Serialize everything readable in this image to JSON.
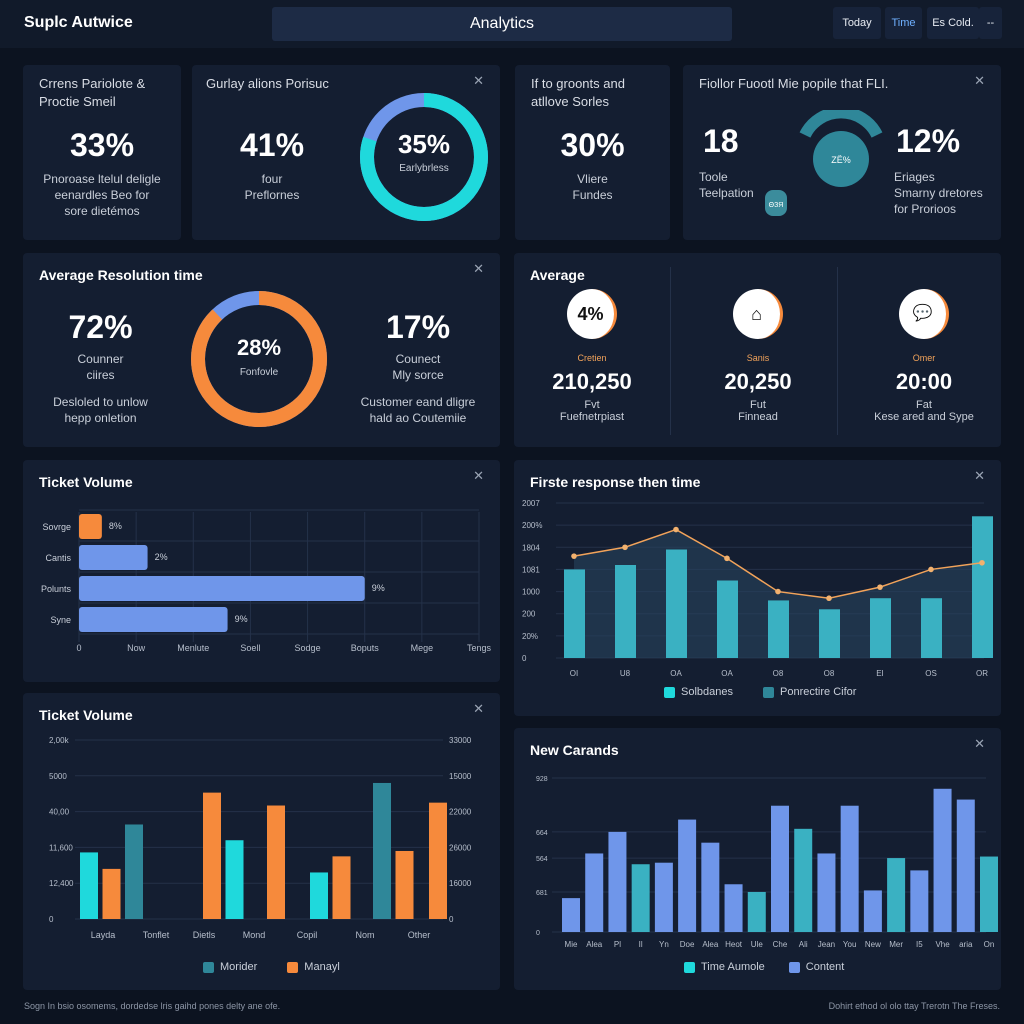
{
  "header": {
    "brand": "Suplc Autwice",
    "title": "Analytics",
    "buttons": [
      "Today",
      "Time",
      "Es Cold.",
      "--"
    ]
  },
  "colors": {
    "cyan": "#1fd9dc",
    "orange": "#f68a3c",
    "blue": "#6f96ea",
    "teal": "#2f8799",
    "bg": "#0c1320",
    "card": "#141e31"
  },
  "row1": [
    {
      "title": "Crrens Pariolote & Proctie Smeil",
      "value": "33%",
      "desc": [
        "Pnoroase ltelul deligle",
        "eenardles Beo for",
        "sore dietémos"
      ]
    },
    {
      "title": "Gurlay alions Porisuc",
      "value": "41%",
      "desc": [
        "four",
        "Preflornes"
      ],
      "donut_value": "35%",
      "donut_label": "Earlybrless",
      "donut_cyan_fraction": 0.8
    },
    {
      "title": "If to groonts and atllove Sorles",
      "value": "30%",
      "desc": [
        "Vliere",
        "Fundes"
      ]
    },
    {
      "title": "Fiollor Fuootl Mie popile that FLI.",
      "value1": "18",
      "desc1": [
        "Toole",
        "Teelpation"
      ],
      "gauge_text": "ZЁ%",
      "bag_text": "ΘЗЯ",
      "value2": "12%",
      "desc2": [
        "Eriages",
        "Smarny dretores",
        "for Prorioos"
      ]
    }
  ],
  "resolution": {
    "title": "Average Resolution time",
    "left_value": "72%",
    "left_desc": [
      "Counner",
      "ciires"
    ],
    "left_note": [
      "Desloled to unlow",
      "hepp onletion"
    ],
    "donut_value": "28%",
    "donut_label": "Fonfovle",
    "donut_orange_fraction": 0.88,
    "right_value": "17%",
    "right_desc": [
      "Counect",
      "Mly sorce"
    ],
    "right_note": [
      "Customer eand dligre",
      "hald ao Coutemiie"
    ]
  },
  "average": {
    "title": "Average",
    "items": [
      {
        "icon": "percent-icon",
        "icon_text": "4%",
        "label": "Cretien",
        "value": "210,250",
        "unit": "Fvt",
        "desc": "Fuefnetrpiast"
      },
      {
        "icon": "home-icon",
        "label": "Sanis",
        "value": "20,250",
        "unit": "Fut",
        "desc": "Finnead"
      },
      {
        "icon": "chat-icon",
        "label": "Omer",
        "value": "20:00",
        "unit": "Fat",
        "desc": "Kese ared and Sype"
      }
    ]
  },
  "chart_data": [
    {
      "type": "bar",
      "orientation": "horizontal",
      "title": "Ticket Volume",
      "categories": [
        "Sovrge",
        "Cantis",
        "Polunts",
        "Syne"
      ],
      "values": [
        0.4,
        1.2,
        5.0,
        2.6
      ],
      "data_labels": [
        "8%",
        "2%",
        "9%",
        "9%"
      ],
      "colors": [
        "#f68a3c",
        "#6f96ea",
        "#6f96ea",
        "#6f96ea"
      ],
      "xticks": [
        "0",
        "Now",
        "Menlute",
        "Soell",
        "Sodge",
        "Boputs",
        "Mege",
        "Tengs"
      ],
      "xlim": [
        0,
        7
      ],
      "grid": true
    },
    {
      "type": "bar+line",
      "title": "Firste response then time",
      "categories": [
        "OI",
        "U8",
        "OA",
        "OA",
        "O8",
        "O8",
        "EI",
        "OS",
        "OR"
      ],
      "yticks": [
        "0",
        "20%",
        "200",
        "1000",
        "1081",
        "1804",
        "200%",
        "2007"
      ],
      "ylim": [
        0,
        7
      ],
      "series": [
        {
          "name": "Solbdanes",
          "type": "bar",
          "color": "#3ab1c2",
          "values": [
            4.0,
            4.2,
            4.9,
            3.5,
            2.6,
            2.2,
            2.7,
            2.7,
            6.4
          ]
        },
        {
          "name": "Ponrectire Cifor",
          "type": "line",
          "color": "#f2a35a",
          "values": [
            4.6,
            5.0,
            5.8,
            4.5,
            3.0,
            2.7,
            3.2,
            4.0,
            4.3
          ]
        }
      ],
      "legend": "bottom",
      "grid": true
    },
    {
      "type": "bar",
      "title": "Ticket Volume",
      "categories": [
        "Layda",
        "Tonflet",
        "Dietls",
        "Mond",
        "Copil",
        "Nom",
        "Other"
      ],
      "yticks_left": [
        "0",
        "12,400",
        "11,600",
        "40,00",
        "5000",
        "2,00k"
      ],
      "yticks_right": [
        "0",
        "16000",
        "26000",
        "22000",
        "15000",
        "33000"
      ],
      "ylim": [
        0,
        5
      ],
      "bars": [
        {
          "category": "Layda",
          "series": "cyan",
          "value": 1.86
        },
        {
          "category": "Layda",
          "series": "Manayl",
          "value": 1.4
        },
        {
          "category": "Layda",
          "series": "Morider",
          "value": 2.64
        },
        {
          "category": "Dietls",
          "series": "Manayl",
          "value": 3.53
        },
        {
          "category": "Dietls",
          "series": "cyan",
          "value": 2.2
        },
        {
          "category": "Mond",
          "series": "Manayl",
          "value": 3.17
        },
        {
          "category": "Copil",
          "series": "cyan",
          "value": 1.3
        },
        {
          "category": "Copil",
          "series": "Manayl",
          "value": 1.75
        },
        {
          "category": "Nom",
          "series": "Morider",
          "value": 3.8
        },
        {
          "category": "Nom",
          "series": "Manayl",
          "value": 1.9
        },
        {
          "category": "Other",
          "series": "Manayl",
          "value": 3.25
        }
      ],
      "legend_entries": [
        {
          "name": "Morider",
          "color": "#2f8799"
        },
        {
          "name": "Manayl",
          "color": "#f68a3c"
        }
      ],
      "legend": "bottom",
      "grid": true
    },
    {
      "type": "bar",
      "title": "New Carands",
      "categories": [
        "Mie",
        "Alea",
        "Pl",
        "Il",
        "Yn",
        "Doe",
        "Alea",
        "Heot",
        "Ule",
        "Che",
        "Ali",
        "Jean",
        "You",
        "New",
        "Mer",
        "I5",
        "Vhe",
        "aria",
        "On"
      ],
      "values": [
        22,
        51,
        65,
        44,
        45,
        73,
        58,
        31,
        26,
        82,
        67,
        51,
        82,
        27,
        48,
        40,
        93,
        86,
        49
      ],
      "series_of_bar": [
        "Content",
        "Content",
        "Content",
        "Time Aumole",
        "Content",
        "Content",
        "Content",
        "Content",
        "Time Aumole",
        "Content",
        "Time Aumole",
        "Content",
        "Content",
        "Content",
        "Time Aumole",
        "Content",
        "Content",
        "Content",
        "Time Aumole"
      ],
      "yticks": [
        "0",
        "681",
        "564",
        "664",
        "928"
      ],
      "ylim": [
        0,
        100
      ],
      "legend_entries": [
        {
          "name": "Time Aumole",
          "color": "#3ab1c2"
        },
        {
          "name": "Content",
          "color": "#6f96ea"
        }
      ],
      "legend": "bottom",
      "grid": true
    }
  ],
  "footer": {
    "left": "Sogn In bsio osomems, dordedse lris gaihd pones delty ane ofe.",
    "right": "Dohirt ethod ol olo ttay Trerotn The Freses."
  }
}
